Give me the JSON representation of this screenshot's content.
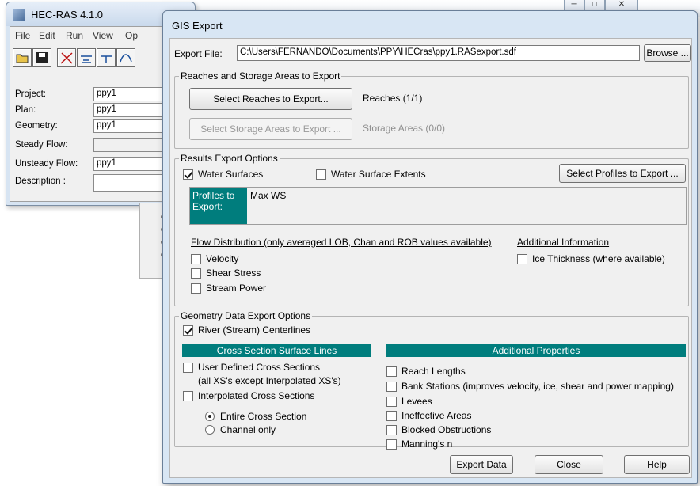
{
  "main_window": {
    "title": "HEC-RAS 4.1.0",
    "menu": [
      "File",
      "Edit",
      "Run",
      "View",
      "Op"
    ],
    "toolbar_icons": [
      "open-folder-icon",
      "save-icon",
      "geometry-icon",
      "steady-flow-icon",
      "unsteady-flow-icon",
      "quasi-unsteady-icon"
    ],
    "fields": [
      {
        "label": "Project:",
        "value": "ppy1"
      },
      {
        "label": "Plan:",
        "value": "ppy1"
      },
      {
        "label": "Geometry:",
        "value": "ppy1"
      },
      {
        "label": "Steady Flow:",
        "value": ""
      },
      {
        "label": "Unsteady Flow:",
        "value": "ppy1"
      },
      {
        "label": "Description :",
        "value": ""
      }
    ]
  },
  "dialog": {
    "title": "GIS Export",
    "export_file_label": "Export File:",
    "export_file_value": "C:\\Users\\FERNANDO\\Documents\\PPY\\HECras\\ppy1.RASexport.sdf",
    "browse_label": "Browse ...",
    "reaches_group": {
      "title": "Reaches and Storage Areas to Export",
      "select_reaches_label": "Select Reaches to Export...",
      "reaches_status": "Reaches (1/1)",
      "select_storage_label": "Select Storage Areas to Export ...",
      "storage_status": "Storage Areas (0/0)"
    },
    "results_group": {
      "title": "Results Export Options",
      "water_surfaces": {
        "label": "Water Surfaces",
        "checked": true
      },
      "water_surface_extents": {
        "label": "Water Surface Extents",
        "checked": false
      },
      "select_profiles_label": "Select Profiles to Export ...",
      "profiles_tag": "Profiles to Export:",
      "profiles_value": "Max WS",
      "flow_distribution_heading": "Flow Distribution (only averaged LOB, Chan and ROB values available)",
      "flow_items": [
        {
          "label": "Velocity",
          "checked": false
        },
        {
          "label": "Shear Stress",
          "checked": false
        },
        {
          "label": "Stream Power",
          "checked": false
        }
      ],
      "additional_info_heading": "Additional Information",
      "ice_thickness": {
        "label": "Ice Thickness (where available)",
        "checked": false
      }
    },
    "geometry_group": {
      "title": "Geometry Data Export Options",
      "river_centerlines": {
        "label": "River (Stream) Centerlines",
        "checked": true
      },
      "xs_header": "Cross Section Surface Lines",
      "user_defined_xs": {
        "label": "User Defined Cross Sections",
        "checked": false
      },
      "user_defined_note": "(all XS's except Interpolated XS's)",
      "interpolated_xs": {
        "label": "Interpolated Cross Sections",
        "checked": false
      },
      "entire_xs": {
        "label": "Entire Cross Section",
        "selected": true
      },
      "channel_only": {
        "label": "Channel only",
        "selected": false
      },
      "additional_header": "Additional Properties",
      "additional_items": [
        {
          "label": "Reach Lengths",
          "checked": false
        },
        {
          "label": "Bank Stations (improves velocity, ice, shear and power mapping)",
          "checked": false
        },
        {
          "label": "Levees",
          "checked": false
        },
        {
          "label": "Ineffective Areas",
          "checked": false
        },
        {
          "label": "Blocked Obstructions",
          "checked": false
        },
        {
          "label": "Manning's n",
          "checked": false
        }
      ]
    },
    "buttons": {
      "export": "Export Data",
      "close": "Close",
      "help": "Help"
    }
  },
  "colors": {
    "teal": "#007d7d",
    "frame": "#d8e6f4",
    "face": "#f0f0f0"
  }
}
